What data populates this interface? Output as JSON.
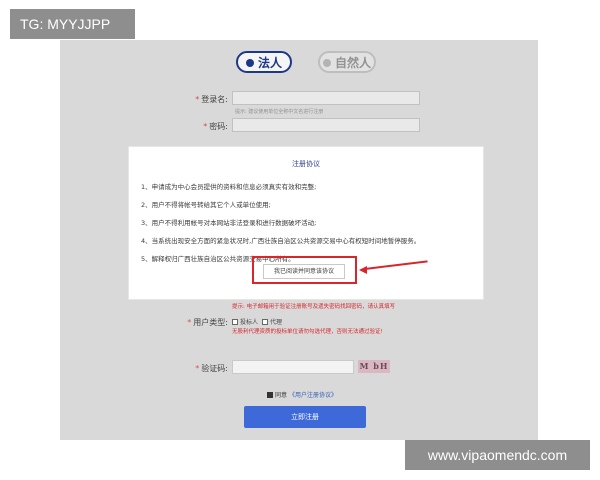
{
  "badges": {
    "top_left": "TG: MYYJJPP",
    "bottom_right": "www.vipaomendc.com"
  },
  "roles": {
    "legal": "法人",
    "natural": "自然人"
  },
  "form": {
    "login_label": "登录名:",
    "login_hint": "提示: 建议使用单位全称中文名进行注册",
    "password_label": "密码:",
    "user_type_label": "用户类型:",
    "user_type_options": [
      "投标人",
      "代理"
    ],
    "captcha_label": "验证码:",
    "captcha_text": "M bH",
    "email_warning": "提示: 电子邮箱用于验证注册账号及遗失密码找回密码，请认真填写",
    "agent_warning": "无股利代理资质的投标单位请勿勾选代理，否则无法通过验证!",
    "agree_prefix": "同意",
    "agree_link": "《用户注册协议》",
    "submit_label": "立即注册"
  },
  "modal": {
    "title": "注册协议",
    "clauses": [
      "1、申请成为中心会员提供的资料和信息必须真实有效和完整;",
      "2、用户不得将帐号转给其它个人或单位使用;",
      "3、用户不得利用帐号对本网站非法登录和进行数据破坏活动;",
      "4、当系统出现安全方面的紧急状况时,广西壮族自治区公共资源交易中心有权短时间地暂停服务。",
      "5、解释权归广西壮族自治区公共资源交易中心所有。"
    ],
    "agree_button": "我已阅读并同意该协议"
  },
  "colors": {
    "accent_blue": "#3d6ad8",
    "annotation_red": "#d8262a",
    "panel_bg": "#e2e2e2"
  }
}
